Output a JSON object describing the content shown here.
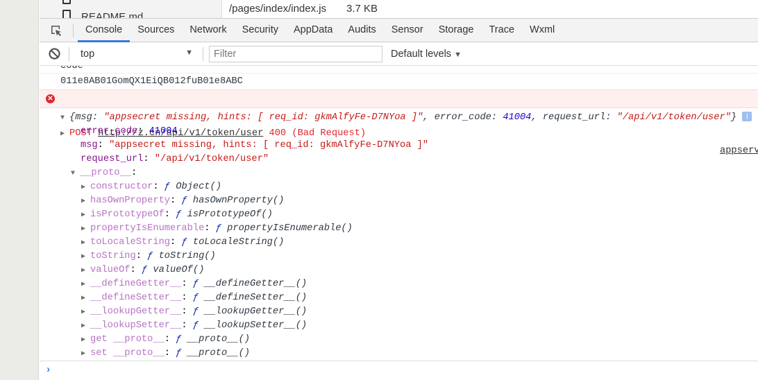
{
  "files": {
    "items": [
      {
        "name": ""
      },
      {
        "name": "README.md"
      }
    ],
    "path": "/pages/index/index.js",
    "size": "3.7 KB"
  },
  "tabs": [
    "Console",
    "Sources",
    "Network",
    "Security",
    "AppData",
    "Audits",
    "Sensor",
    "Storage",
    "Trace",
    "Wxml"
  ],
  "toolbar": {
    "context": "top",
    "filter_placeholder": "Filter",
    "levels": "Default levels"
  },
  "console": {
    "code_label": "code",
    "code_value": "011e8AB01GomQX1EiQB012fuB01e8ABC",
    "error": {
      "method": "POST",
      "url": "http://z.cn/api/v1/token/user",
      "status": "400 (Bad Request)",
      "source": "appserv"
    },
    "object": {
      "summary_open": "{",
      "msg_key": "msg",
      "msg_val": "\"appsecret missing, hints: [ req_id: gkmAlfyFe-D7NYoa ]\"",
      "ec_key": "error_code",
      "ec_val": "41004",
      "ru_key": "request_url",
      "ru_val": "\"/api/v1/token/user\"",
      "summary_close": "}",
      "props": [
        {
          "key": "error_code",
          "value": "41004",
          "type": "num"
        },
        {
          "key": "msg",
          "value": "\"appsecret missing, hints: [ req_id: gkmAlfyFe-D7NYoa ]\"",
          "type": "str"
        },
        {
          "key": "request_url",
          "value": "\"/api/v1/token/user\"",
          "type": "str"
        }
      ],
      "proto_label": "__proto__",
      "proto": [
        {
          "key": "constructor",
          "fn": "Object()"
        },
        {
          "key": "hasOwnProperty",
          "fn": "hasOwnProperty()"
        },
        {
          "key": "isPrototypeOf",
          "fn": "isPrototypeOf()"
        },
        {
          "key": "propertyIsEnumerable",
          "fn": "propertyIsEnumerable()"
        },
        {
          "key": "toLocaleString",
          "fn": "toLocaleString()"
        },
        {
          "key": "toString",
          "fn": "toString()"
        },
        {
          "key": "valueOf",
          "fn": "valueOf()"
        },
        {
          "key": "__defineGetter__",
          "fn": "__defineGetter__()"
        },
        {
          "key": "__defineSetter__",
          "fn": "__defineSetter__()"
        },
        {
          "key": "__lookupGetter__",
          "fn": "__lookupGetter__()"
        },
        {
          "key": "__lookupSetter__",
          "fn": "__lookupSetter__()"
        },
        {
          "key": "get __proto__",
          "fn": "__proto__()"
        },
        {
          "key": "set __proto__",
          "fn": "__proto__()"
        }
      ]
    },
    "prompt": "›",
    "f_symbol": "ƒ"
  },
  "colors": {
    "accent": "#3879d9",
    "error_bg": "#fff0f0",
    "error_text": "#e0262a"
  }
}
